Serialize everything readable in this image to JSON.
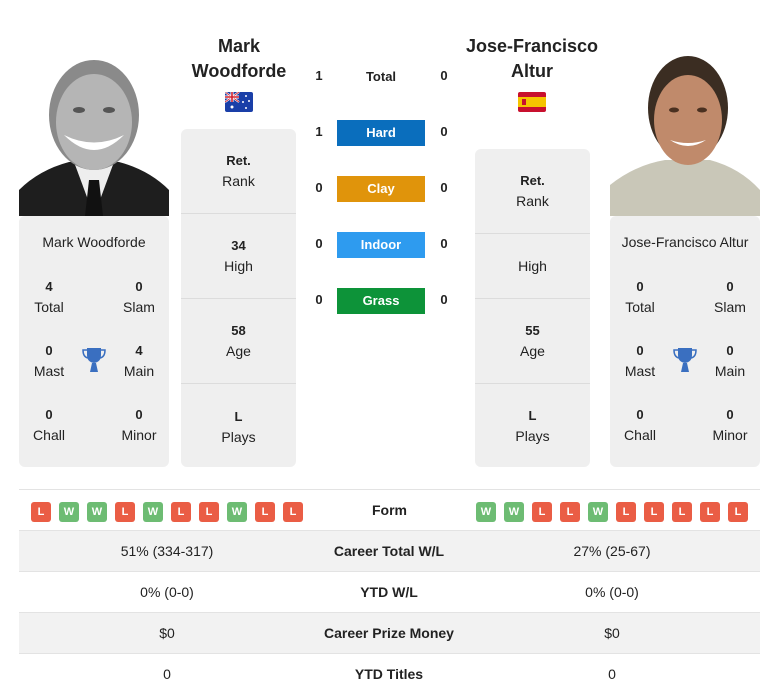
{
  "player1": {
    "name_line1": "Mark",
    "name_line2": "Woodforde",
    "full_name": "Mark Woodforde",
    "flag": "australia-flag",
    "titles": {
      "total": {
        "value": "4",
        "label": "Total"
      },
      "slam": {
        "value": "0",
        "label": "Slam"
      },
      "mast": {
        "value": "0",
        "label": "Mast"
      },
      "main": {
        "value": "4",
        "label": "Main"
      },
      "chall": {
        "value": "0",
        "label": "Chall"
      },
      "minor": {
        "value": "0",
        "label": "Minor"
      }
    },
    "rank": {
      "value": "Ret.",
      "label": "Rank"
    },
    "high": {
      "value": "34",
      "label": "High"
    },
    "age": {
      "value": "58",
      "label": "Age"
    },
    "plays": {
      "value": "L",
      "label": "Plays"
    },
    "form": [
      "L",
      "W",
      "W",
      "L",
      "W",
      "L",
      "L",
      "W",
      "L",
      "L"
    ]
  },
  "player2": {
    "name_line1": "Jose-Francisco",
    "name_line2": "Altur",
    "full_name": "Jose-Francisco Altur",
    "flag": "spain-flag",
    "titles": {
      "total": {
        "value": "0",
        "label": "Total"
      },
      "slam": {
        "value": "0",
        "label": "Slam"
      },
      "mast": {
        "value": "0",
        "label": "Mast"
      },
      "main": {
        "value": "0",
        "label": "Main"
      },
      "chall": {
        "value": "0",
        "label": "Chall"
      },
      "minor": {
        "value": "0",
        "label": "Minor"
      }
    },
    "rank": {
      "value": "Ret.",
      "label": "Rank"
    },
    "high": {
      "value": "",
      "label": "High"
    },
    "age": {
      "value": "55",
      "label": "Age"
    },
    "plays": {
      "value": "L",
      "label": "Plays"
    },
    "form": [
      "W",
      "W",
      "L",
      "L",
      "W",
      "L",
      "L",
      "L",
      "L",
      "L"
    ]
  },
  "h2h": [
    {
      "label": "Total",
      "p1": "1",
      "p2": "0",
      "color": null
    },
    {
      "label": "Hard",
      "p1": "1",
      "p2": "0",
      "color": "#0a6ebd"
    },
    {
      "label": "Clay",
      "p1": "0",
      "p2": "0",
      "color": "#e0940b"
    },
    {
      "label": "Indoor",
      "p1": "0",
      "p2": "0",
      "color": "#2e9bef"
    },
    {
      "label": "Grass",
      "p1": "0",
      "p2": "0",
      "color": "#0d9339"
    }
  ],
  "form_label": "Form",
  "stats": [
    {
      "label": "Career Total W/L",
      "p1": "51% (334-317)",
      "p2": "27% (25-67)"
    },
    {
      "label": "YTD W/L",
      "p1": "0% (0-0)",
      "p2": "0% (0-0)"
    },
    {
      "label": "Career Prize Money",
      "p1": "$0",
      "p2": "$0"
    },
    {
      "label": "YTD Titles",
      "p1": "0",
      "p2": "0"
    }
  ],
  "colors": {
    "win": "#6dbc73",
    "loss": "#ea5d45",
    "trophy": "#3a6fc0"
  }
}
